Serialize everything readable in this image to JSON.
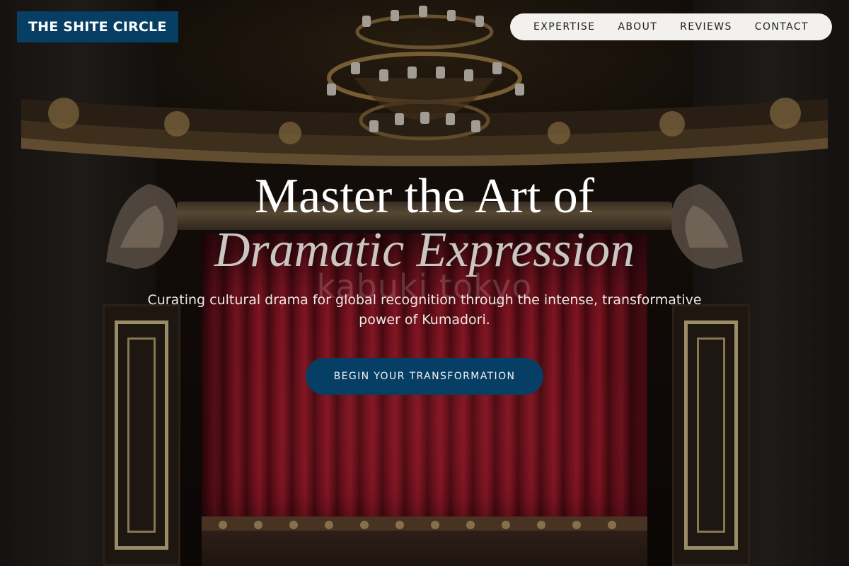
{
  "brand": {
    "logo_text": "THE SHITE CIRCLE",
    "color": "#073e64"
  },
  "nav": {
    "items": [
      {
        "label": "EXPERTISE"
      },
      {
        "label": "ABOUT"
      },
      {
        "label": "REVIEWS"
      },
      {
        "label": "CONTACT"
      }
    ]
  },
  "hero": {
    "title_line1": "Master the Art of",
    "title_line2": "Dramatic Expression",
    "watermark": "kabuki tokyo",
    "subtitle": "Curating cultural drama for global recognition through the intense, transformative power of Kumadori.",
    "cta_label": "BEGIN YOUR TRANSFORMATION"
  },
  "background": {
    "scene": "theatre-stage-with-red-curtain-and-chandelier",
    "curtain_color": "#a3172a",
    "gold_accent": "#e8d59c"
  }
}
